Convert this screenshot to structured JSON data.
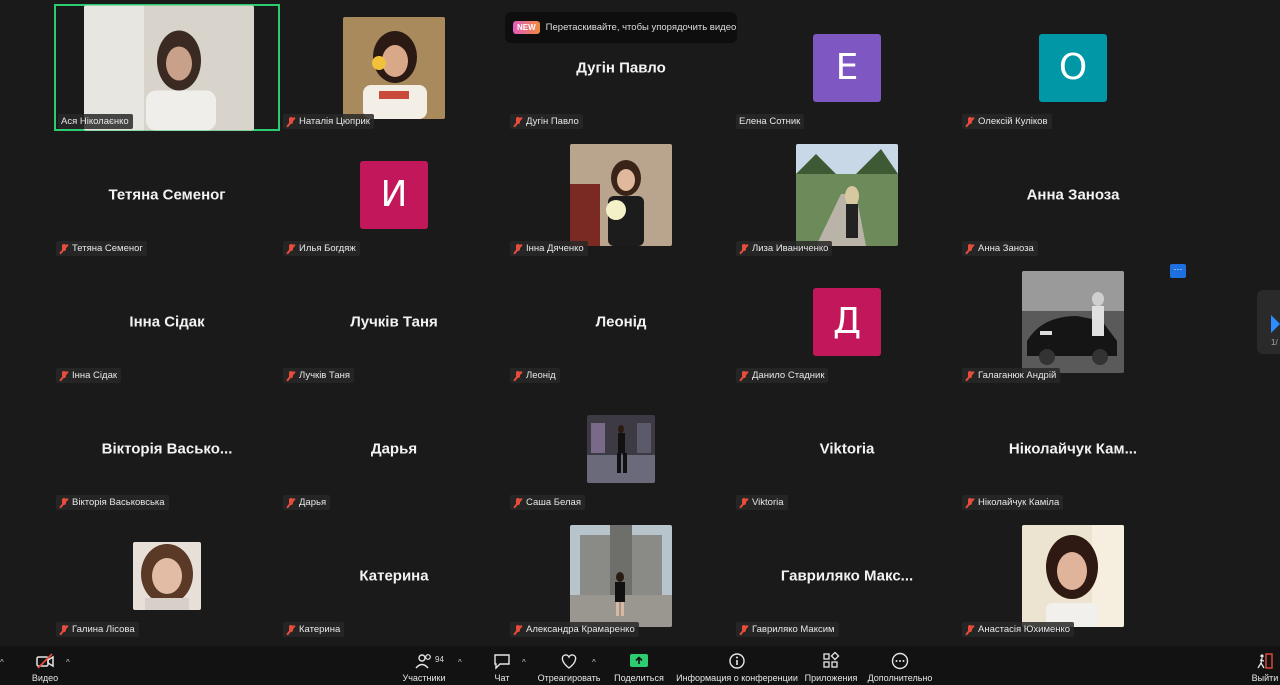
{
  "banner": {
    "badge": "NEW",
    "text": "Перетаскивайте, чтобы упорядочить видео"
  },
  "tiles": {
    "asya": {
      "name": "Ася Ніколаєнко"
    },
    "nataliia": {
      "name": "Наталія Цюприк"
    },
    "duhin": {
      "display": "Дугін Павло",
      "name": "Дугін Павло"
    },
    "olena": {
      "avatar_letter": "Е",
      "avatar_color": "#7e57c2",
      "name": "Елена Сотник"
    },
    "oleksii": {
      "avatar_letter": "О",
      "avatar_color": "#0097a7",
      "name": "Олексій Куліков"
    },
    "tetiana": {
      "display": "Тетяна Семеног",
      "name": "Тетяна Семеног"
    },
    "illia": {
      "avatar_letter": "И",
      "avatar_color": "#c2185b",
      "name": "Илья Богдяж"
    },
    "inna_d": {
      "name": "Інна Дяченко"
    },
    "liza": {
      "name": "Лиза Иваниченко"
    },
    "anna": {
      "display": "Анна Заноза",
      "name": "Анна Заноза"
    },
    "inna_s": {
      "display": "Інна Сідак",
      "name": "Інна Сідак"
    },
    "luchkiv": {
      "display": "Лучків Таня",
      "name": "Лучків Таня"
    },
    "leonid": {
      "display": "Леонід",
      "name": "Леонід"
    },
    "danylo": {
      "avatar_letter": "Д",
      "avatar_color": "#c2185b",
      "name": "Данило Стадник"
    },
    "halahaniuk": {
      "name": "Галаганюк Андрій"
    },
    "viktoriia": {
      "display": "Вікторія Васько...",
      "name": "Вікторія Васьковська"
    },
    "darya": {
      "display": "Дарья",
      "name": "Дарья"
    },
    "sasha": {
      "name": "Саша Белая"
    },
    "viktoria_en": {
      "display": "Viktoria",
      "name": "Viktoria"
    },
    "nikolaichuk": {
      "display": "Ніколайчук Кам...",
      "name": "Ніколайчук Каміла"
    },
    "halyna": {
      "name": "Галина Лісова"
    },
    "kateryna": {
      "display": "Катерина",
      "name": "Катерина"
    },
    "oleksandra": {
      "name": "Александра Крамаренко"
    },
    "havryliako": {
      "display": "Гавриляко Макс...",
      "name": "Гавриляко Максим"
    },
    "anastasiia": {
      "name": "Анастасія Юхименко"
    }
  },
  "more_button": "···",
  "page_indicator": "1/",
  "toolbar": {
    "video": "Видео",
    "participants": "Участники",
    "participants_count": "94",
    "chat": "Чат",
    "react": "Отреагировать",
    "share": "Поделиться",
    "info": "Информация о конференции",
    "apps": "Приложения",
    "more": "Дополнительно",
    "leave": "Выйти",
    "accent": "#2ecc71",
    "leave_color": "#e74c3c"
  }
}
